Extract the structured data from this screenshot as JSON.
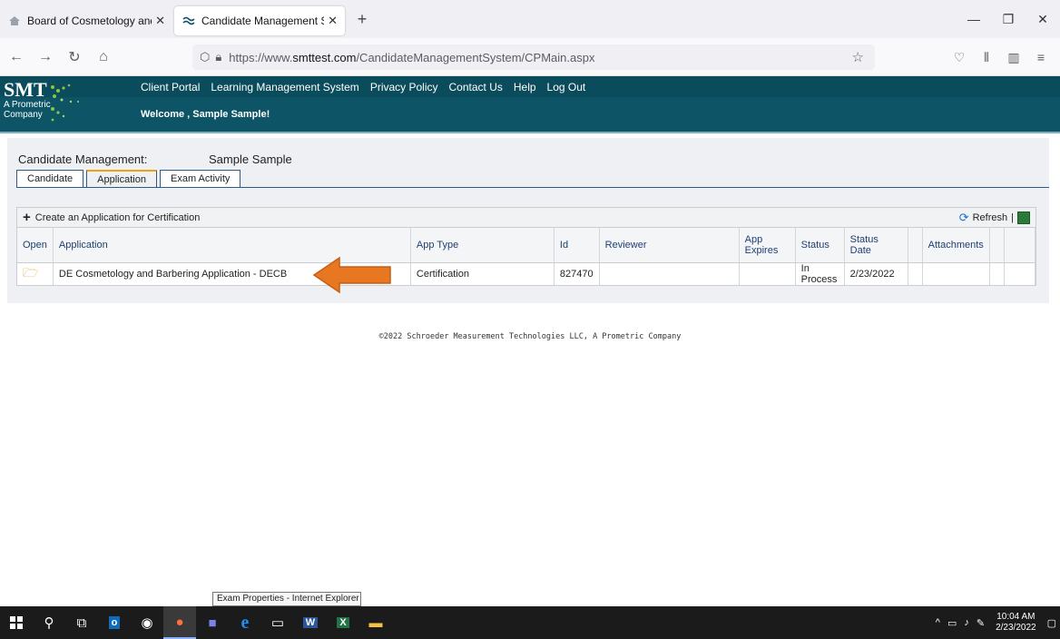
{
  "browser": {
    "tabs": [
      {
        "label": "Board of Cosmetology and Barb",
        "active": false
      },
      {
        "label": "Candidate Management System",
        "active": true
      }
    ],
    "url_prefix": "https://www.",
    "url_domain": "smttest.com",
    "url_path": "/CandidateManagementSystem/CPMain.aspx"
  },
  "header": {
    "logo_text": "SMT",
    "logo_sub1": "A Prometric",
    "logo_sub2": "Company",
    "nav": [
      "Client Portal",
      "Learning Management System",
      "Privacy Policy",
      "Contact Us",
      "Help",
      "Log Out"
    ],
    "welcome": "Welcome , Sample Sample!"
  },
  "candidate": {
    "title": "Candidate Management:",
    "name": "Sample Sample",
    "tabs": [
      "Candidate",
      "Application",
      "Exam Activity"
    ],
    "active_tab": "Application"
  },
  "grid": {
    "create_label": "Create an Application for Certification",
    "refresh_label": "Refresh",
    "columns": [
      "Open",
      "Application",
      "App Type",
      "Id",
      "Reviewer",
      "App Expires",
      "Status",
      "Status Date",
      "",
      "Attachments",
      "",
      ""
    ],
    "rows": [
      {
        "application": "DE Cosmetology and Barbering Application - DECB",
        "app_type": "Certification",
        "id": "827470",
        "reviewer": "",
        "app_expires": "",
        "status": "In Process",
        "status_date": "2/23/2022",
        "attachments": ""
      }
    ]
  },
  "footer": "©2022 Schroeder Measurement Technologies LLC, A Prometric Company",
  "tooltip": "Exam Properties - Internet Explorer",
  "taskbar": {
    "time": "10:04 AM",
    "date": "2/23/2022"
  },
  "colors": {
    "header": "#0d5466",
    "arrow": "#e87722",
    "tab_accent": "#e8a317"
  }
}
